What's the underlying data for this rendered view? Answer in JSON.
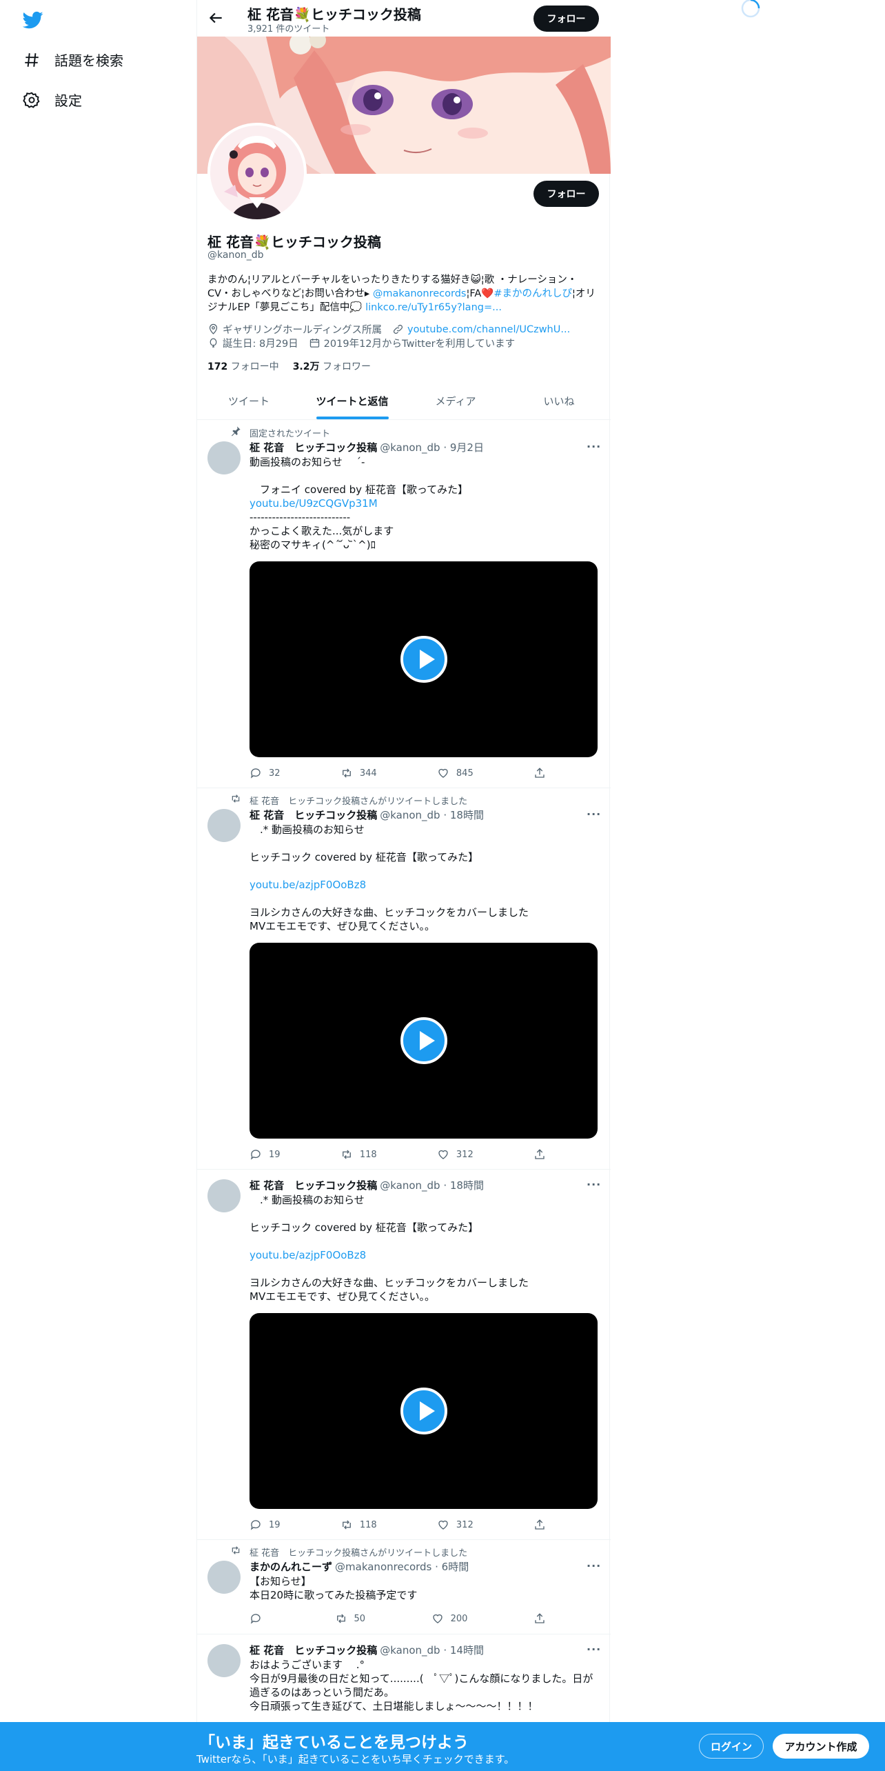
{
  "nav": {
    "explore_label": "話題を検索",
    "settings_label": "設定"
  },
  "header": {
    "title": "柾 花音💐ヒッチコック投稿",
    "tweet_count": "3,921 件のツイート",
    "follow_label": "フォロー"
  },
  "profile": {
    "follow_label": "フォロー",
    "name": "柾 花音💐ヒッチコック投稿",
    "handle": "@kanon_db",
    "bio_1": "まかのん¦リアルとバーチャルをいったりきたりする猫好き😺¦歌 ・ナレーション・CV・おしゃべりなど¦お問い合わせ▸ ",
    "bio_link_1": "@makanonrecords",
    "bio_2": "¦FA❤️",
    "bio_link_2": "#まかのんれしぴ",
    "bio_3": "¦オリジナルEP「夢見ごこち」配信中💭 ",
    "bio_link_3": "linkco.re/uTy1r65y?lang=...",
    "location": "ギャザリングホールディングス所属",
    "website": "youtube.com/channel/UCzwhU...",
    "birthday": "誕生日: 8月29日",
    "joined": "2019年12月からTwitterを利用しています",
    "following_count": "172",
    "following_label": "フォロー中",
    "followers_count": "3.2万",
    "followers_label": "フォロワー"
  },
  "tabs": [
    "ツイート",
    "ツイートと返信",
    "メディア",
    "いいね"
  ],
  "active_tab": "ツイートと返信",
  "tweets": [
    {
      "context": "固定されたツイート",
      "name": "柾 花音　ヒッチコック投稿",
      "meta": "@kanon_db · 9月2日",
      "text_1": "動画投稿のお知らせ　 ˊ-\n\n　フォニイ covered by 柾花音【歌ってみた】",
      "link": "youtu.be/U9zCQGVp31M",
      "text_2": "---------------------------\nかっこよく歌えた...気がします\n秘密のマサキィ(^ˊ ᷄ᴗ ᷅ˋ^)ﾛ",
      "replies": "32",
      "retweets": "344",
      "likes": "845"
    },
    {
      "context": "柾 花音　ヒッチコック投稿さんがリツイートしました",
      "name": "柾 花音　ヒッチコック投稿",
      "meta": "@kanon_db · 18時間",
      "text_1": "　.* 動画投稿のお知らせ\n\nヒッチコック covered by 柾花音【歌ってみた】\n",
      "link": "youtu.be/azjpF0OoBz8",
      "text_2": "ヨルシカさんの大好きな曲、ヒッチコックをカバーしました\nMVエモエモです、ぜひ見てください。。",
      "replies": "19",
      "retweets": "118",
      "likes": "312"
    },
    {
      "name": "柾 花音　ヒッチコック投稿",
      "meta": "@kanon_db · 18時間",
      "text_1": "　.* 動画投稿のお知らせ\n\nヒッチコック covered by 柾花音【歌ってみた】\n",
      "link": "youtu.be/azjpF0OoBz8",
      "text_2": "ヨルシカさんの大好きな曲、ヒッチコックをカバーしました\nMVエモエモです、ぜひ見てください。。",
      "replies": "19",
      "retweets": "118",
      "likes": "312"
    },
    {
      "context": "柾 花音　ヒッチコック投稿さんがリツイートしました",
      "name": "まかのんれこーず",
      "meta": "@makanonrecords · 6時間",
      "text_1": "【お知らせ】\n本日20時に歌ってみた投稿予定です",
      "replies": "",
      "retweets": "50",
      "likes": "200"
    },
    {
      "name": "柾 花音　ヒッチコック投稿",
      "meta": "@kanon_db · 14時間",
      "text_1": "おはようございます　 .°\n今日が9月最後の日だと知って.........(　ﾟ▽ﾟ)こんな顔になりました。日が過ぎるのはあっという間だあ。\n今日頑張って生き延びて、土日堪能しましょ〜〜〜〜！！！！"
    }
  ],
  "bottom_bar": {
    "title": "「いま」起きていることを見つけよう",
    "subtitle": "Twitterなら、「いま」起きていることをいち早くチェックできます。",
    "login_label": "ログイン",
    "signup_label": "アカウント作成"
  },
  "colors": {
    "accent": "#1d9bf0",
    "text": "#0f1419",
    "muted": "#536471"
  }
}
